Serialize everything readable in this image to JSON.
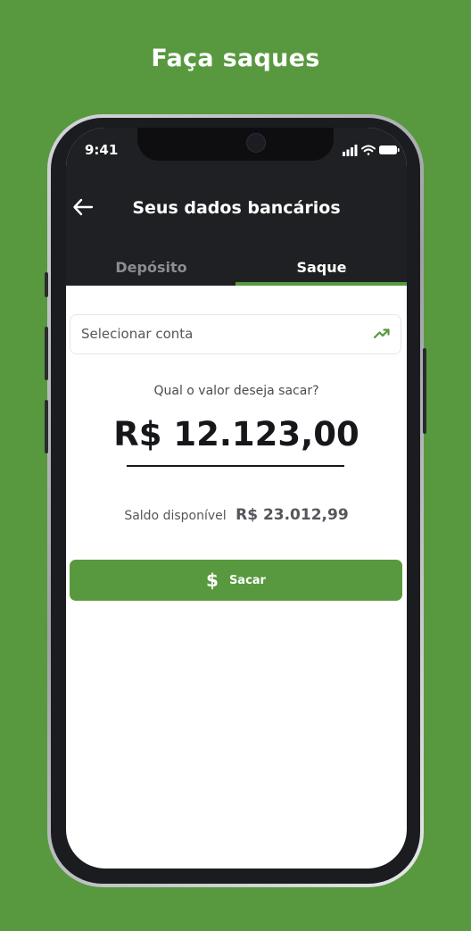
{
  "headline": "Faça saques",
  "status_bar": {
    "time": "9:41"
  },
  "nav": {
    "title": "Seus dados bancários"
  },
  "tabs": [
    {
      "label": "Depósito",
      "active": false
    },
    {
      "label": "Saque",
      "active": true
    }
  ],
  "account_select": {
    "placeholder": "Selecionar conta",
    "icon": "trending-up-icon"
  },
  "withdraw": {
    "prompt": "Qual o valor deseja sacar?",
    "amount": "R$ 12.123,00",
    "balance_label": "Saldo disponível",
    "balance_value": "R$ 23.012,99",
    "button_label": "Sacar",
    "button_icon": "$"
  },
  "colors": {
    "accent": "#58993f",
    "header": "#1f2023"
  }
}
